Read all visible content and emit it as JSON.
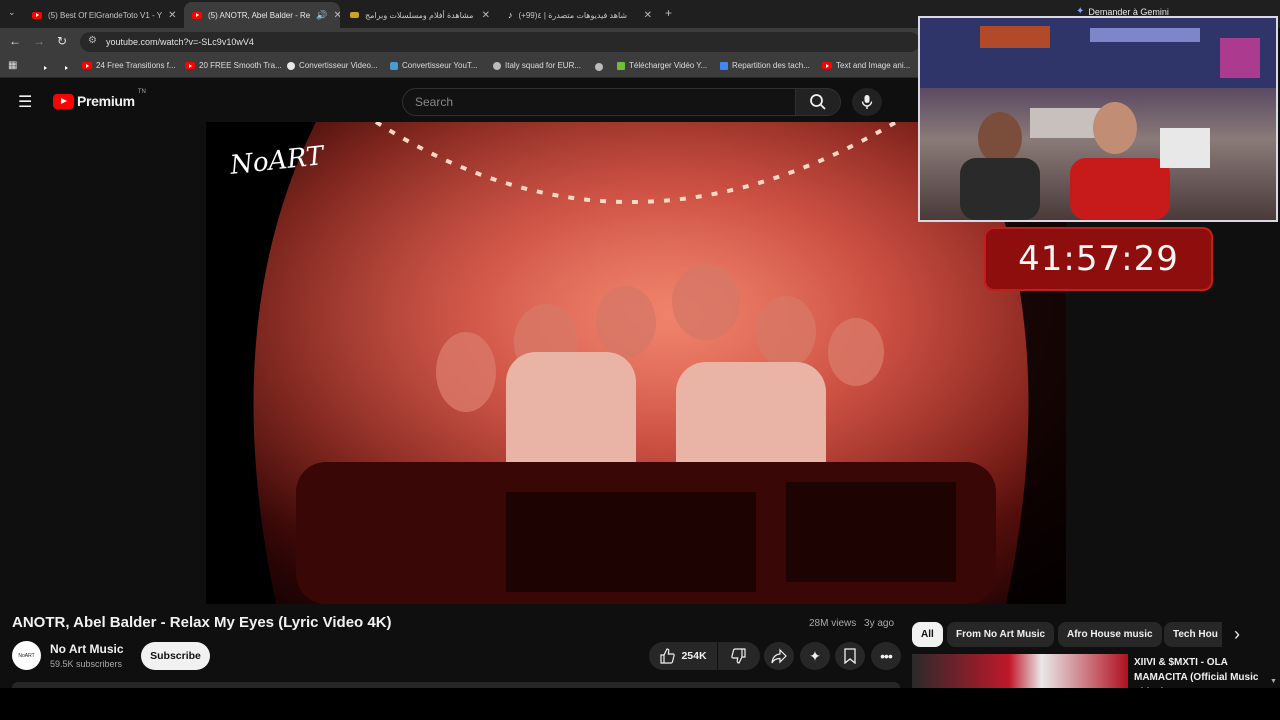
{
  "browser": {
    "tabs": [
      {
        "label": "(5) Best Of ElGrandeToto V1 - Y"
      },
      {
        "label": "(5) ANOTR, Abel Balder - Re"
      },
      {
        "label": "مشاهدة أفلام ومسلسلات وبرامج"
      },
      {
        "label": "(+99)شاهد فيديوهات متصدرة | ٤"
      }
    ],
    "url": "youtube.com/watch?v=-SLc9v10wV4",
    "gemini_label": "Demander à Gemini",
    "bookmarks": [
      {
        "label": "24 Free Transitions f..."
      },
      {
        "label": "20 FREE Smooth Tra..."
      },
      {
        "label": "Convertisseur Video..."
      },
      {
        "label": "Convertisseur YouT..."
      },
      {
        "label": "Italy squad for EUR..."
      },
      {
        "label": "Télécharger Vidéo Y..."
      },
      {
        "label": "Repartition des tach..."
      },
      {
        "label": "Text and Image ani..."
      }
    ]
  },
  "youtube": {
    "logo_text": "Premium",
    "country_code": "TN",
    "search_placeholder": "Search"
  },
  "video": {
    "overlay_logo": "NoART",
    "timer": "41:57:29",
    "title": "ANOTR, Abel Balder - Relax My Eyes (Lyric Video 4K)",
    "views": "28M views",
    "age": "3y ago",
    "channel": "No Art Music",
    "subscribers": "59.5K subscribers",
    "subscribe_label": "Subscribe",
    "likes": "254K"
  },
  "chips": [
    {
      "label": "All"
    },
    {
      "label": "From No Art Music"
    },
    {
      "label": "Afro House music"
    },
    {
      "label": "Tech Hou"
    }
  ],
  "recommendation": {
    "title": "XIIVI & $MXTI - OLA MAMACITA (Official Music Video)"
  },
  "colors": {
    "brand_red": "#ff0000",
    "timer_bg": "#8e0e0e",
    "background": "#0f0f0f"
  }
}
